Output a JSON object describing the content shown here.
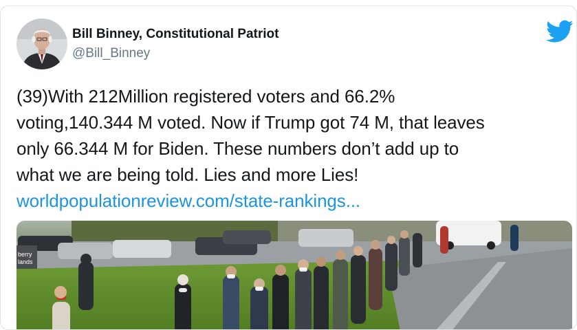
{
  "author": {
    "display_name": "Bill Binney, Constitutional Patriot",
    "handle": "@Bill_Binney"
  },
  "tweet": {
    "lines": [
      "(39)With 212Million registered voters and 66.2%",
      "voting,140.344 M voted.  Now if Trump got 74 M, that leaves",
      "only 66.344 M for Biden.  These numbers don’t add up to",
      "what we are being told. Lies and more Lies!"
    ],
    "link_text": "worldpopulationreview.com/state-rankings..."
  },
  "media": {
    "sign_text": "berry\nlands"
  },
  "icons": {
    "brand": "twitter-bird-icon"
  },
  "colors": {
    "accent": "#1da1f2",
    "link": "#1b95e0",
    "text": "#14171a",
    "secondary": "#657786"
  }
}
